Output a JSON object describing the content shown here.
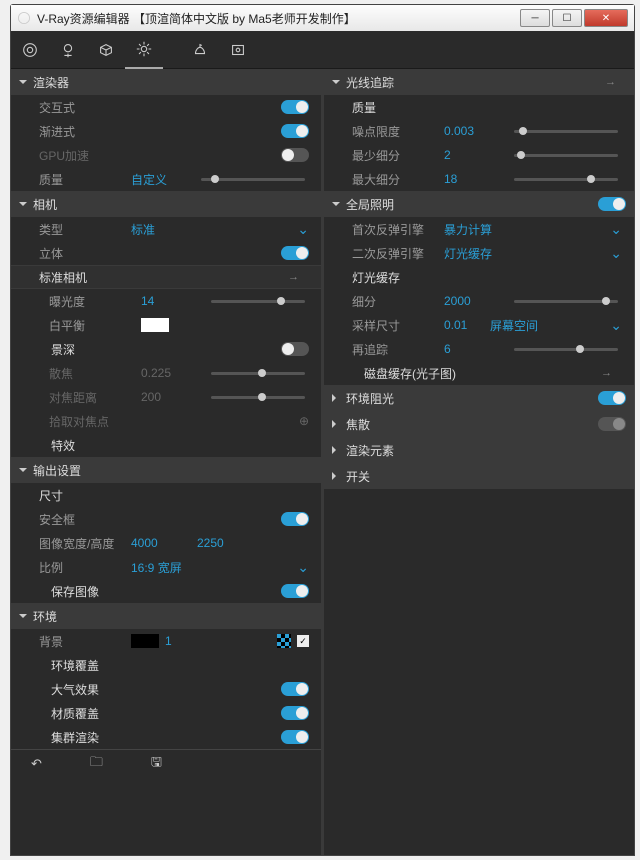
{
  "window": {
    "title": "V-Ray资源编辑器 【顶渲简体中文版 by Ma5老师开发制作】"
  },
  "winbtns": {
    "close": "✕"
  },
  "left": {
    "renderer": {
      "title": "渲染器",
      "interactive": "交互式",
      "progressive": "渐进式",
      "gpu": "GPU加速",
      "quality": "质量",
      "quality_val": "自定义"
    },
    "camera": {
      "title": "相机",
      "type": "类型",
      "type_val": "标准",
      "stereo": "立体",
      "std_camera": "标准相机",
      "exposure": "曝光度",
      "exposure_val": "14",
      "wb": "白平衡",
      "dof": "景深",
      "defocus": "散焦",
      "defocus_val": "0.225",
      "focus_dist": "对焦距离",
      "focus_dist_val": "200",
      "pick_focus": "拾取对焦点",
      "fx": "特效"
    },
    "output": {
      "title": "输出设置",
      "size": "尺寸",
      "safe": "安全框",
      "dims": "图像宽度/高度",
      "w": "4000",
      "h": "2250",
      "ratio": "比例",
      "ratio_val": "16:9 宽屏",
      "save": "保存图像"
    },
    "env": {
      "title": "环境",
      "bg": "背景",
      "bg_val": "1",
      "override": "环境覆盖",
      "atmo": "大气效果",
      "mat_override": "材质覆盖",
      "cluster": "集群渲染"
    }
  },
  "right": {
    "raytrace": {
      "title": "光线追踪",
      "quality": "质量",
      "noise": "噪点限度",
      "noise_val": "0.003",
      "min_sub": "最少细分",
      "min_sub_val": "2",
      "max_sub": "最大细分",
      "max_sub_val": "18"
    },
    "gi": {
      "title": "全局照明",
      "primary": "首次反弹引擎",
      "primary_val": "暴力计算",
      "secondary": "二次反弹引擎",
      "secondary_val": "灯光缓存",
      "lightcache": "灯光缓存",
      "subdiv": "细分",
      "subdiv_val": "2000",
      "sample": "采样尺寸",
      "sample_val": "0.01",
      "sample_mode": "屏幕空间",
      "retrace": "再追踪",
      "retrace_val": "6",
      "diskcache": "磁盘缓存(光子图)"
    },
    "ao": "环境阻光",
    "caustics": "焦散",
    "render_elem": "渲染元素",
    "switches": "开关"
  },
  "footer": {}
}
